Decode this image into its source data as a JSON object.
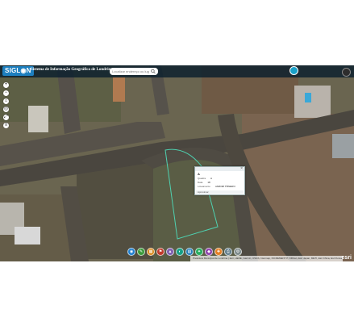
{
  "header": {
    "logo": "SIGL◉N",
    "title": "Sistema de Informação Geográfica de Londrina"
  },
  "search": {
    "placeholder": "Localizar endereço ou lugar"
  },
  "zoom_buttons": [
    {
      "glyph": "+",
      "icon": "zoom-in-icon"
    },
    {
      "glyph": "−",
      "icon": "zoom-out-icon"
    },
    {
      "glyph": "⌂",
      "icon": "home-icon"
    },
    {
      "glyph": "◎",
      "icon": "locate-icon"
    },
    {
      "glyph": "⤢",
      "icon": "fullscreen-icon"
    },
    {
      "glyph": "≡",
      "icon": "layers-icon"
    }
  ],
  "popup": {
    "title": "A",
    "close": "×",
    "rows": [
      {
        "label": "Quadra",
        "value": "A"
      },
      {
        "label": "Data",
        "value": "18"
      },
      {
        "label": "Loteamento",
        "value": "JARDIM TÍ0NERO"
      }
    ],
    "footer": "Aproximar"
  },
  "toolbar": [
    {
      "glyph": "◉",
      "color": "#1f7fcf",
      "icon": "info-icon"
    },
    {
      "glyph": "✎",
      "color": "#3a9a3a",
      "icon": "draw-icon"
    },
    {
      "glyph": "▦",
      "color": "#d98a1e",
      "icon": "grid-icon"
    },
    {
      "glyph": "⚑",
      "color": "#c0392b",
      "icon": "flag-icon"
    },
    {
      "glyph": "▲",
      "color": "#7f5fb0",
      "icon": "triangle-icon"
    },
    {
      "glyph": "◐",
      "color": "#16a085",
      "icon": "contrast-icon"
    },
    {
      "glyph": "▤",
      "color": "#2980b9",
      "icon": "list-icon"
    },
    {
      "glyph": "✦",
      "color": "#27ae60",
      "icon": "star-icon"
    },
    {
      "glyph": "◆",
      "color": "#8e44ad",
      "icon": "diamond-icon"
    },
    {
      "glyph": "✚",
      "color": "#e67e22",
      "icon": "plus-icon"
    },
    {
      "glyph": "⎙",
      "color": "#607d8b",
      "icon": "print-icon"
    },
    {
      "glyph": "⚙",
      "color": "#7f8c8d",
      "icon": "gear-icon"
    }
  ],
  "attribution": "Prefeitura Municipal de Londrina | Esri, HERE, Garmin, USGS, Intermap, INCREMENT P, NRCan, Esri Japan, METI, Esri China, Esri Korea",
  "esri_logo": "esri",
  "colors": {
    "topbar": "#0a1e2d",
    "accent": "#1d7fbf",
    "road": "#4a463f",
    "lot_outline": "#4fd1b0"
  }
}
